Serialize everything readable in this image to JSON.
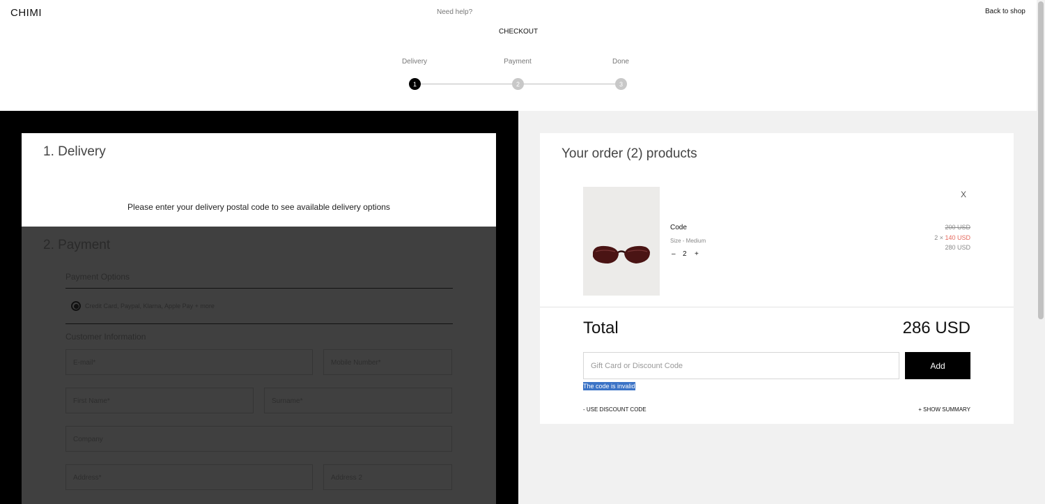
{
  "header": {
    "logo": "CHIMI",
    "help": "Need help?",
    "back": "Back to shop",
    "title": "CHECKOUT"
  },
  "steps": [
    {
      "label": "Delivery",
      "number": "1",
      "state": "active"
    },
    {
      "label": "Payment",
      "number": "2",
      "state": "idle"
    },
    {
      "label": "Done",
      "number": "3",
      "state": "idle"
    }
  ],
  "delivery": {
    "title": "1. Delivery",
    "message": "Please enter your delivery postal code to see available delivery options"
  },
  "payment": {
    "title": "2. Payment",
    "options_label": "Payment Options",
    "option_text": "Credit Card, Paypal, Klarna, Apple Pay + more",
    "customer_label": "Customer Information",
    "fields": {
      "email": "E-mail*",
      "mobile": "Mobile Number*",
      "first_name": "First Name*",
      "surname": "Surname*",
      "company": "Company",
      "address": "Address*",
      "address2": "Address 2"
    }
  },
  "order": {
    "title": "Your order (2) products",
    "product": {
      "name": "Code",
      "size": "Size - Medium",
      "qty_minus": "–",
      "qty": "2",
      "qty_plus": "+",
      "remove": "X",
      "price_old": "200 USD",
      "price_multiplier": "2 × ",
      "price_new": "140 USD",
      "price_total": "280 USD"
    },
    "total_label": "Total",
    "total_value": "286 USD",
    "code_placeholder": "Gift Card or Discount Code",
    "add_label": "Add",
    "code_error": "The code is invalid",
    "use_code": "- USE DISCOUNT CODE",
    "show_summary": "+ SHOW SUMMARY"
  },
  "colors": {
    "accent": "#000000",
    "sale": "#e5675b",
    "error_highlight": "#3b73c6"
  }
}
